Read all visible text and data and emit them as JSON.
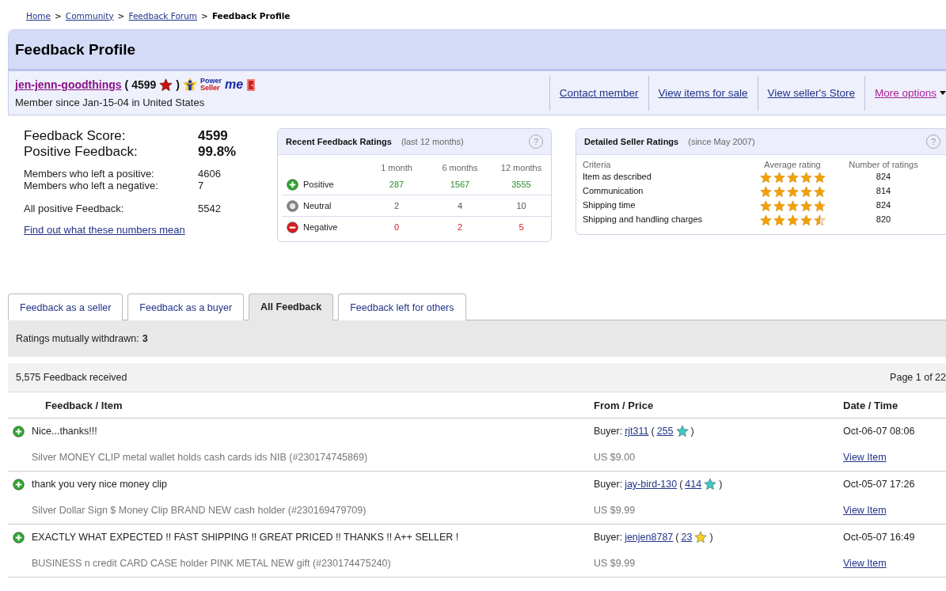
{
  "breadcrumb": [
    {
      "label": "Home",
      "link": true
    },
    {
      "label": "Community",
      "link": true
    },
    {
      "label": "Feedback Forum",
      "link": true
    },
    {
      "label": "Feedback Profile",
      "link": false
    }
  ],
  "separator": ">",
  "title": "Feedback Profile",
  "member": {
    "name": "jen-jenn-goodthings",
    "open": "(",
    "score": "4599",
    "close": ")",
    "badge_top": "Power",
    "badge_bottom": "Seller",
    "me": "me",
    "since": "Member since Jan-15-04 in United States"
  },
  "actions": [
    {
      "label": "Contact member",
      "visited": false
    },
    {
      "label": "View items for sale",
      "visited": false
    },
    {
      "label": "View seller's Store",
      "visited": false
    },
    {
      "label": "More options",
      "visited": true
    }
  ],
  "summary": {
    "score_label": "Feedback Score:",
    "score": "4599",
    "positive_label": "Positive Feedback:",
    "positive": "99.8%",
    "stats": [
      {
        "label": "Members who left a positive:",
        "value": "4606"
      },
      {
        "label": "Members who left a negative:",
        "value": "7"
      },
      {
        "label": "All positive Feedback:",
        "value": "5542"
      }
    ],
    "link": "Find out what these numbers mean"
  },
  "recent": {
    "title": "Recent Feedback Ratings",
    "note": "(last 12 months)",
    "help": "?",
    "columns": [
      "1 month",
      "6 months",
      "12 months"
    ],
    "rows": [
      {
        "kind": "positive",
        "label": "Positive",
        "values": [
          "287",
          "1567",
          "3555"
        ]
      },
      {
        "kind": "neutral",
        "label": "Neutral",
        "values": [
          "2",
          "4",
          "10"
        ]
      },
      {
        "kind": "negative",
        "label": "Negative",
        "values": [
          "0",
          "2",
          "5"
        ]
      }
    ]
  },
  "detailed": {
    "title": "Detailed Seller Ratings",
    "note": "(since May 2007)",
    "help": "?",
    "columns": [
      "Criteria",
      "Average rating",
      "Number of ratings"
    ],
    "rows": [
      {
        "label": "Item as described",
        "stars": 5,
        "count": "824"
      },
      {
        "label": "Communication",
        "stars": 4.8,
        "count": "814"
      },
      {
        "label": "Shipping time",
        "stars": 4.8,
        "count": "824"
      },
      {
        "label": "Shipping and handling charges",
        "stars": 4.5,
        "count": "820"
      }
    ]
  },
  "tabs": [
    {
      "label": "Feedback as a seller",
      "selected": false
    },
    {
      "label": "Feedback as a buyer",
      "selected": false
    },
    {
      "label": "All Feedback",
      "selected": true
    },
    {
      "label": "Feedback left for others",
      "selected": false
    }
  ],
  "withdrawn": {
    "label": "Ratings mutually withdrawn:",
    "value": "3"
  },
  "received": "5,575 Feedback received",
  "page": "Page 1 of 22",
  "columns": [
    "Feedback / Item",
    "From / Price",
    "Date / Time"
  ],
  "entries": [
    {
      "kind": "positive",
      "comment": "Nice...thanks!!!",
      "item": "Silver MONEY CLIP metal wallet holds cash cards ids NIB (#230174745869)",
      "role": "Buyer:",
      "buyer": "rjt311",
      "open": "(",
      "buyer_score": "255",
      "close": ")",
      "color": "#3cc8c0",
      "price": "US $9.00",
      "date": "Oct-06-07 08:06",
      "view": "View Item"
    },
    {
      "kind": "positive",
      "comment": "thank you very nice money clip",
      "item": "Silver Dollar Sign $ Money Clip BRAND NEW cash holder (#230169479709)",
      "role": "Buyer:",
      "buyer": "jay-bird-130",
      "open": "(",
      "buyer_score": "414",
      "close": ")",
      "color": "#3cc8c0",
      "price": "US $9.99",
      "date": "Oct-05-07 17:26",
      "view": "View Item"
    },
    {
      "kind": "positive",
      "comment": "EXACTLY WHAT EXPECTED !! FAST SHIPPING !! GREAT PRICED !! THANKS !! A++ SELLER !",
      "item": "BUSINESS n credit CARD CASE holder PINK METAL NEW gift (#230174475240)",
      "role": "Buyer:",
      "buyer": "jenjen8787",
      "open": "(",
      "buyer_score": "23",
      "close": ")",
      "color": "#f5d020",
      "price": "US $9.99",
      "date": "Oct-05-07 16:49",
      "view": "View Item"
    }
  ]
}
